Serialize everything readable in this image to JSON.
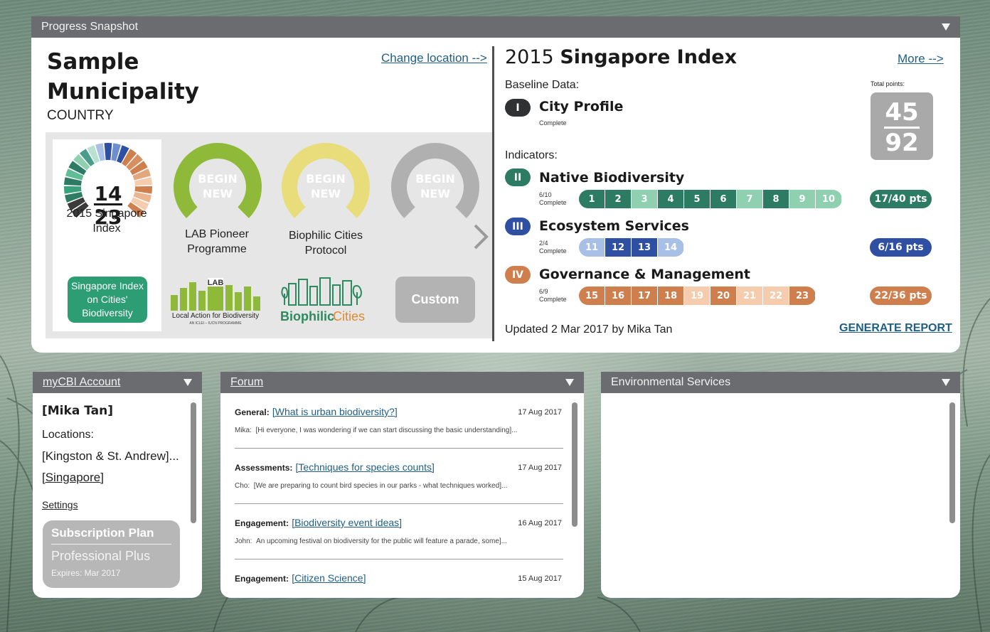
{
  "colors": {
    "header": "#6b6c6f",
    "green_dark": "#2d7b63",
    "green_light": "#8ed0b0",
    "blue_dark": "#2f4fa2",
    "blue_light": "#a8c0e6",
    "orange_dark": "#cf7f4e",
    "orange_light": "#f6ccae",
    "link": "#1f5f86",
    "gray_badge": "#a9a9a9",
    "lab_green": "#8fb939",
    "biophilic_yellow": "#e8dd7a"
  },
  "progress": {
    "header": "Progress Snapshot",
    "municipality": "Sample Municipality",
    "country": "COUNTRY",
    "change_location": "Change location -->",
    "gauges": [
      {
        "top": "14",
        "bottom": "23",
        "label": "2015 Singapore Index",
        "button": "Singapore Index on Cities' Biodiversity"
      },
      {
        "top": "BEGIN",
        "bottom": "NEW",
        "label": "LAB Pioneer Programme",
        "logo_title": "LAB",
        "logo_sub": "Local Action for Biodiversity",
        "logo_tag": "AN ICLEI – IUCN PROGRAMME"
      },
      {
        "top": "BEGIN",
        "bottom": "NEW",
        "label": "Biophilic Cities Protocol",
        "logo_a": "Biophilic",
        "logo_b": "Cities"
      },
      {
        "top": "BEGIN",
        "bottom": "NEW",
        "label": "",
        "button": "Custom"
      }
    ]
  },
  "index": {
    "year": "2015",
    "name": "Singapore Index",
    "more": "More -->",
    "baseline_label": "Baseline Data:",
    "indicators_label": "Indicators:",
    "total_label": "Total points:",
    "total_earned": "45",
    "total_possible": "92",
    "baseline": {
      "roman": "I",
      "title": "City Profile",
      "status": "Complete"
    },
    "sections": [
      {
        "roman": "II",
        "title": "Native Biodiversity",
        "count": "6/10",
        "status": "Complete",
        "pts": "17/40 pts",
        "items": [
          "1",
          "2",
          "3",
          "4",
          "5",
          "6",
          "7",
          "8",
          "9",
          "10"
        ],
        "done": [
          true,
          true,
          false,
          true,
          true,
          true,
          false,
          true,
          false,
          false
        ]
      },
      {
        "roman": "III",
        "title": "Ecosystem Services",
        "count": "2/4",
        "status": "Complete",
        "pts": "6/16 pts",
        "items": [
          "11",
          "12",
          "13",
          "14"
        ],
        "done": [
          false,
          true,
          true,
          false
        ]
      },
      {
        "roman": "IV",
        "title": "Governance & Management",
        "count": "6/9",
        "status": "Complete",
        "pts": "22/36 pts",
        "items": [
          "15",
          "16",
          "17",
          "18",
          "19",
          "20",
          "21",
          "22",
          "23"
        ],
        "done": [
          true,
          true,
          true,
          true,
          false,
          true,
          false,
          false,
          true
        ]
      }
    ],
    "updated": "Updated 2 Mar 2017 by Mika Tan",
    "generate": "GENERATE REPORT"
  },
  "account": {
    "header": "myCBI Account",
    "name": "[Mika Tan]",
    "locations_label": "Locations:",
    "location1": "[Kingston & St. Andrew]...",
    "location2": "[Singapore]",
    "settings": "Settings",
    "plan_title": "Subscription Plan",
    "plan_name": "Professional Plus",
    "plan_expires": "Expires:  Mar 2017"
  },
  "forum": {
    "header": "Forum",
    "posts": [
      {
        "category": "General:",
        "title": "[What is urban biodiversity?]",
        "date": "17 Aug 2017",
        "author": "Mika:",
        "excerpt": "[Hi everyone, I was wondering if we can start discussing the basic understanding]..."
      },
      {
        "category": "Assessments:",
        "title": "[Techniques for species counts]",
        "date": "17 Aug 2017",
        "author": "Cho:",
        "excerpt": "[We are preparing to count bird species in our parks - what techniques worked]..."
      },
      {
        "category": "Engagement:",
        "title": "[Biodiversity event ideas]",
        "date": "16 Aug 2017",
        "author": "John:",
        "excerpt": "An upcoming festival on biodiversity for the public will feature a parade, some]..."
      },
      {
        "category": "Engagement:",
        "title": "[Citizen Science]",
        "date": "15 Aug 2017",
        "author": "",
        "excerpt": ""
      }
    ]
  },
  "env": {
    "header": "Environmental Services"
  }
}
